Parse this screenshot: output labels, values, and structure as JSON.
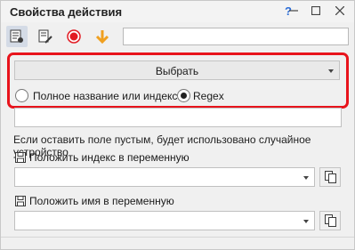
{
  "window": {
    "title": "Свойства действия",
    "help_label": "?",
    "minimize_label": "—",
    "maximize_label": "☐",
    "close_label": "✕"
  },
  "toolbar": {
    "icons": [
      "properties-icon",
      "edit-icon",
      "record-icon",
      "arrow-down-icon"
    ],
    "search_value": ""
  },
  "device_select": {
    "label": "Выбрать"
  },
  "match_mode": {
    "options": [
      {
        "label": "Полное название или индекс:",
        "selected": false
      },
      {
        "label": "Regex",
        "selected": true
      }
    ]
  },
  "pattern_input": {
    "value": ""
  },
  "hint": "Если оставить поле пустым, будет использовано случайное устройство",
  "save_index": {
    "label": "Положить индекс в переменную",
    "value": ""
  },
  "save_name": {
    "label": "Положить имя в переменную",
    "value": ""
  },
  "colors": {
    "highlight": "#e8141c",
    "record": "#e21b23",
    "arrow": "#f0a020",
    "help": "#2b6cd6"
  }
}
